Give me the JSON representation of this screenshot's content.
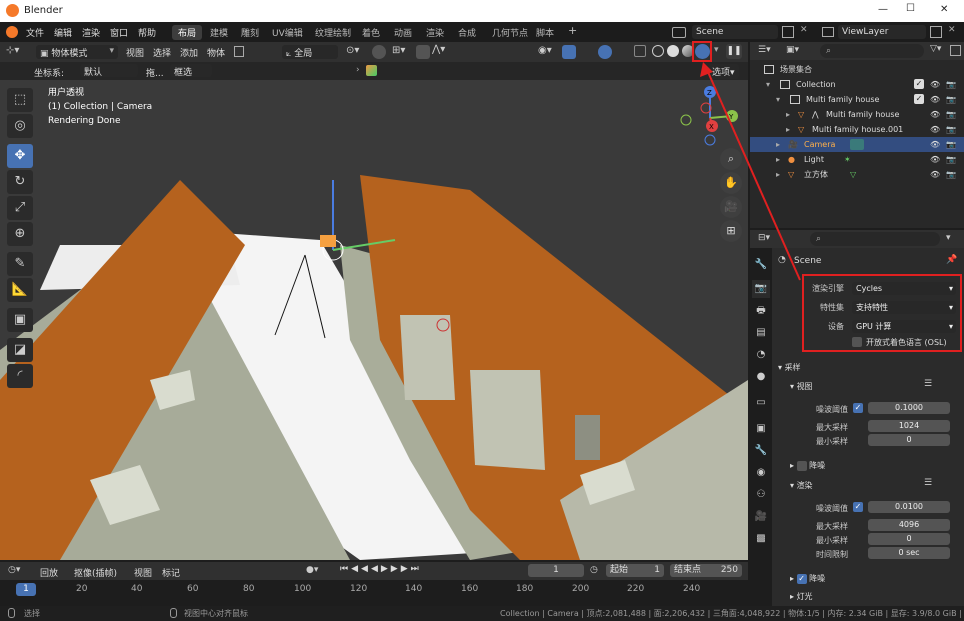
{
  "app": {
    "title": "Blender"
  },
  "titlebar": {
    "minimize": "—",
    "maximize": "☐",
    "close": "✕"
  },
  "menu": [
    "文件",
    "编辑",
    "渲染",
    "窗口",
    "帮助"
  ],
  "workspaces": [
    "布局",
    "建模",
    "雕刻",
    "UV编辑",
    "纹理绘制",
    "着色",
    "动画",
    "渲染",
    "合成",
    "几何节点",
    "脚本"
  ],
  "workspace_add": "+",
  "scene_name": "Scene",
  "view_layer": "ViewLayer",
  "viewport_header": {
    "mode": "物体模式",
    "menus": [
      "视图",
      "选择",
      "添加",
      "物体"
    ],
    "transform_orientation": "全局",
    "options": "选项"
  },
  "viewport_header2": {
    "coord_label": "坐标系:",
    "coord_value": "默认",
    "drag_label": "拖...",
    "select_value": "框选"
  },
  "viewport_overlay": {
    "line1": "用户透视",
    "line2": "(1) Collection | Camera",
    "line3": "Rendering Done"
  },
  "gizmo": {
    "x": "X",
    "y": "Y",
    "z": "Z"
  },
  "timeline": {
    "playback": "回放",
    "keying": "抠像(插帧)",
    "view": "视图",
    "marker": "标记",
    "current_frame": "1",
    "start_label": "起始",
    "start_value": "1",
    "end_label": "结束点",
    "end_value": "250",
    "ticks": [
      "1",
      "20",
      "40",
      "60",
      "80",
      "100",
      "120",
      "140",
      "160",
      "180",
      "200",
      "220",
      "240"
    ]
  },
  "statusbar": {
    "left1": "选择",
    "left2": "视图中心对齐鼠标",
    "right": "Collection | Camera | 顶点:2,081,488 | 面:2,206,432 | 三角面:4,048,922 | 物体:1/5 | 内存: 2.34 GiB | 显存: 3.9/8.0 GiB | 3.6"
  },
  "outliner": {
    "rows": [
      {
        "label": "场景集合",
        "indent": 0
      },
      {
        "label": "Collection",
        "indent": 1
      },
      {
        "label": "Multi family house",
        "indent": 2
      },
      {
        "label": "Multi family house",
        "indent": 3
      },
      {
        "label": "Multi family house.001",
        "indent": 3
      },
      {
        "label": "Camera",
        "indent": 2
      },
      {
        "label": "Light",
        "indent": 2
      },
      {
        "label": "立方体",
        "indent": 2
      }
    ]
  },
  "properties": {
    "scene_label": "Scene",
    "render_engine_label": "渲染引擎",
    "render_engine_value": "Cycles",
    "feature_set_label": "特性集",
    "feature_set_value": "支持特性",
    "device_label": "设备",
    "device_value": "GPU 计算",
    "osl_label": "开放式着色语言 (OSL)",
    "sampling_label": "采样",
    "viewport_label": "视图",
    "noise_threshold_label": "噪波阈值",
    "viewport_noise_value": "0.1000",
    "max_samples_label": "最大采样",
    "viewport_max_samples": "1024",
    "min_samples_label": "最小采样",
    "viewport_min_samples": "0",
    "denoise_label": "降噪",
    "render_label": "渲染",
    "render_noise_value": "0.0100",
    "render_max_samples": "4096",
    "render_min_samples": "0",
    "time_limit_label": "时间限制",
    "time_limit_value": "0 sec",
    "render_denoise_label": "降噪",
    "lights_label": "灯光"
  },
  "colors": {
    "accent": "#4772b3",
    "highlight_box": "#e02020",
    "roof": "#b5621e",
    "wall": "#a9ad9a"
  }
}
